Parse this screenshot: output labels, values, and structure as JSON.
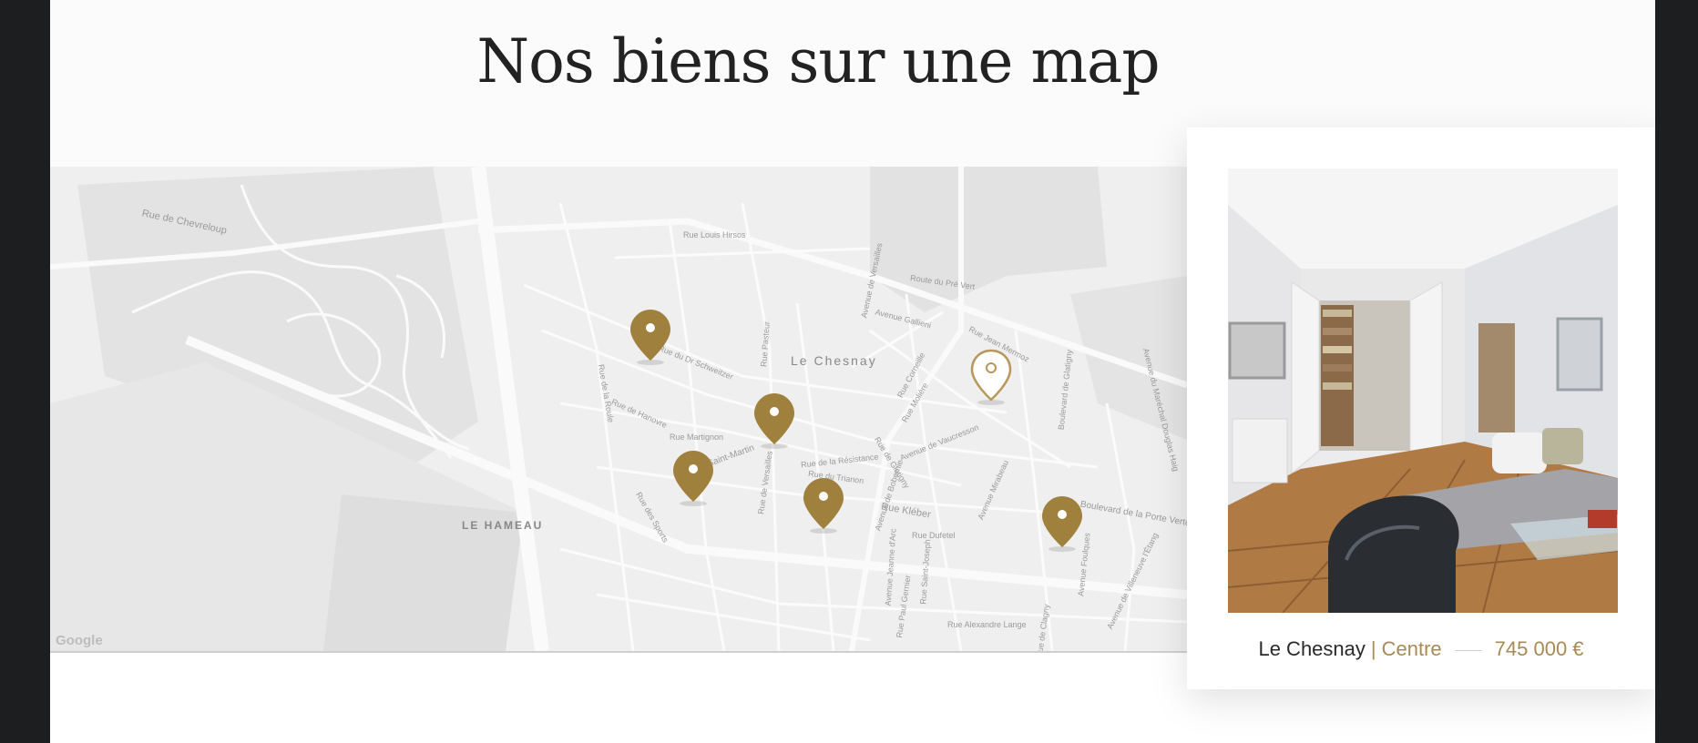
{
  "section": {
    "title": "Nos biens sur une map"
  },
  "map": {
    "district_labels": [
      "Le Chesnay",
      "LE HAMEAU"
    ],
    "street_labels": [
      "Rue de Chevreloup",
      "Rue Louis Hirsos",
      "Avenue de Versailles",
      "Route du Pré Vert",
      "Avenue Gallieni",
      "Rue du Dr Schweitzer",
      "Rue de Hanovre",
      "Rue Martignon",
      "Rue Saint-Martin",
      "Rue de Versailles",
      "Rue de la Résistance",
      "Rue du Trianon",
      "Avenue de Bobernie",
      "Rue de Glatigny",
      "Avenue de Vaucresson",
      "Rue Kléber",
      "Rue Dufetel",
      "Avenue Mirabeau",
      "Boulevard de Glatigny",
      "Boulevard de la Porte Verte",
      "Rue des Sports",
      "Rue Alexandre Lange",
      "Avenue de Villeneuve l'Étang",
      "Rue Pasteur",
      "Avenue Jeanne d'Arc",
      "Rue Paul Gernier",
      "Rue Saint-Joseph",
      "Avenue Foulques",
      "Rue de Clagny",
      "Avenue du Maréchal Douglas Haig",
      "Rue de la Roule",
      "Rue Molière",
      "Rue Corneille",
      "Rue Jean Mermoz"
    ],
    "attribution": "Google",
    "markers": [
      {
        "state": "default"
      },
      {
        "state": "default"
      },
      {
        "state": "default"
      },
      {
        "state": "default"
      },
      {
        "state": "default"
      },
      {
        "state": "selected"
      }
    ],
    "colors": {
      "pin": "#a0803d",
      "pin_selected_fill": "#ffffff",
      "pin_selected_stroke": "#b8975a"
    }
  },
  "listing": {
    "city": "Le Chesnay",
    "separator": "|",
    "district": "Centre",
    "price": "745 000 €"
  },
  "colors": {
    "accent": "#a88a55",
    "frame": "#1d1e20"
  }
}
